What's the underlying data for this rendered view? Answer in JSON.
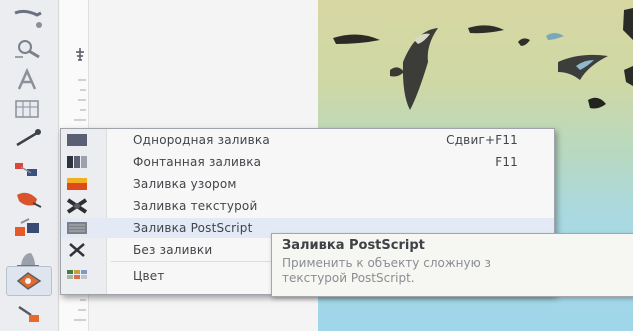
{
  "toolbox": {
    "tools": [
      {
        "icon": "pick-shape-icon"
      },
      {
        "icon": "zoom-icon"
      },
      {
        "icon": "text-A-icon"
      },
      {
        "icon": "table-icon"
      },
      {
        "icon": "connector-line-icon"
      },
      {
        "icon": "interactive-blend-icon"
      },
      {
        "icon": "eyedropper-icon"
      },
      {
        "icon": "outline-pen-icon"
      },
      {
        "icon": "fill-bucket-icon"
      },
      {
        "icon": "smart-fill-icon"
      }
    ]
  },
  "fill_menu": {
    "items": [
      {
        "label": "Однородная заливка",
        "shortcut": "Сдвиг+F11",
        "icon": "uniform-fill-icon",
        "color": "#5a5f73"
      },
      {
        "label": "Фонтанная заливка",
        "shortcut": "F11",
        "icon": "fountain-fill-icon",
        "color": "#2e3240"
      },
      {
        "label": "Заливка узором",
        "shortcut": "",
        "icon": "pattern-fill-icon",
        "color": "#e04a1a"
      },
      {
        "label": "Заливка текстурой",
        "shortcut": "",
        "icon": "texture-fill-icon",
        "color": "#2b2f33"
      },
      {
        "label": "Заливка PostScript",
        "shortcut": "",
        "icon": "postscript-fill-icon",
        "color": "#7c8088"
      },
      {
        "label": "Без заливки",
        "shortcut": "",
        "icon": "no-fill-x-icon",
        "color": "#2f3338"
      },
      {
        "label": "Цвет",
        "shortcut": "",
        "icon": "color-palette-icon",
        "color": "#4a7a4a"
      }
    ]
  },
  "tooltip": {
    "title": "Заливка PostScript",
    "description": "Применить к объекту сложную з\nтекстурой PostScript."
  },
  "colors": {
    "menu_background": "#f7f7f7",
    "menu_strip": "#ebedf1",
    "highlight": "#e3eaf6",
    "canvas_top": "#d7d7a2",
    "canvas_bottom": "#9fd6ea"
  }
}
